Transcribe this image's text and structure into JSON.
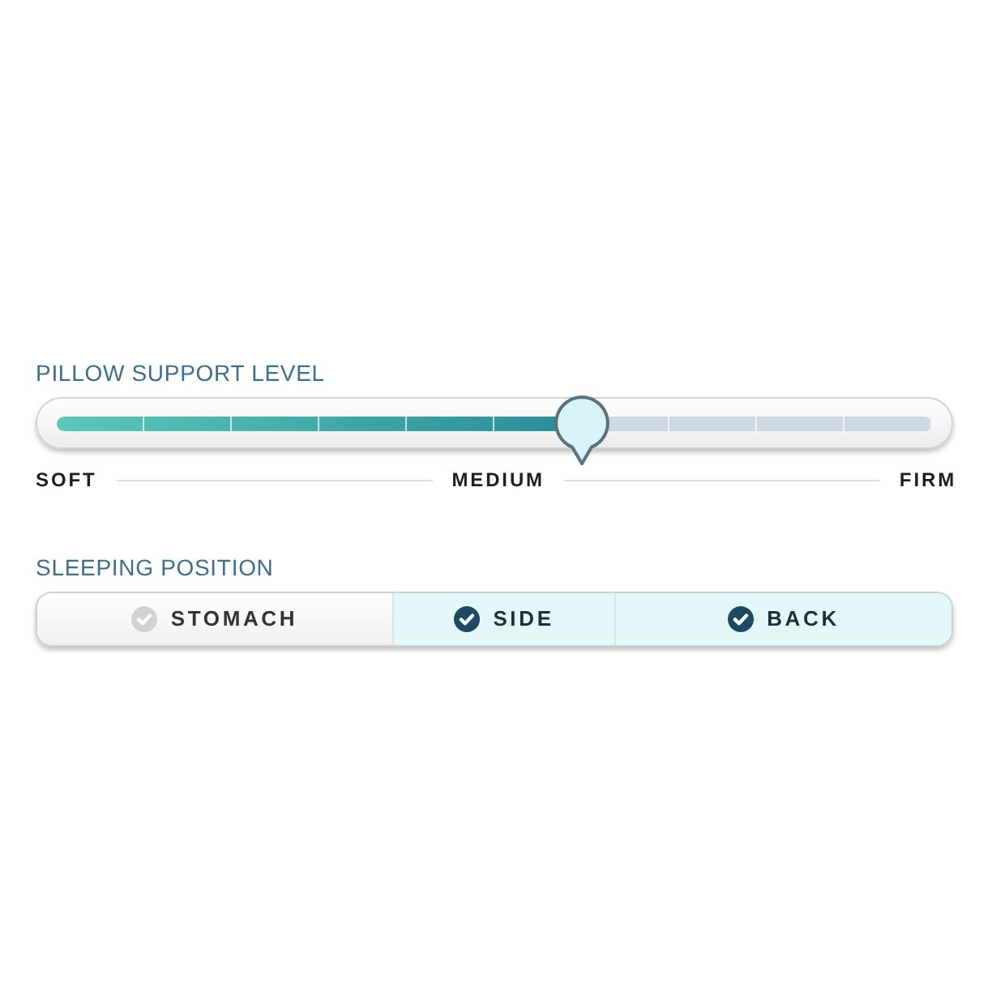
{
  "support": {
    "title": "PILLOW SUPPORT LEVEL",
    "level": 0.6,
    "labels": [
      "SOFT",
      "MEDIUM",
      "FIRM"
    ]
  },
  "position": {
    "title": "SLEEPING POSITION",
    "options": [
      {
        "label": "STOMACH",
        "selected": false
      },
      {
        "label": "SIDE",
        "selected": true
      },
      {
        "label": "BACK",
        "selected": true
      }
    ]
  }
}
